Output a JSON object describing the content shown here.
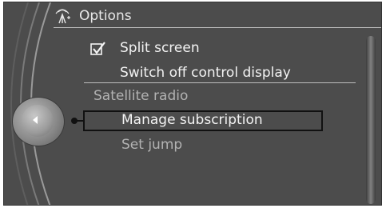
{
  "header": {
    "title": "Options",
    "icon": "antenna-signal-icon"
  },
  "menu": {
    "items": [
      {
        "label": "Split screen",
        "checked": true,
        "enabled": true
      },
      {
        "label": "Switch off control display",
        "enabled": true
      }
    ],
    "section_heading": "Satellite radio",
    "section_items": [
      {
        "label": "Manage subscription",
        "enabled": true,
        "selected": true
      },
      {
        "label": "Set jump",
        "enabled": false
      }
    ]
  },
  "colors": {
    "background": "#4c4c4c",
    "text": "#f3f3f3",
    "text_disabled": "#b2b2b2",
    "selection_border": "#111111"
  }
}
